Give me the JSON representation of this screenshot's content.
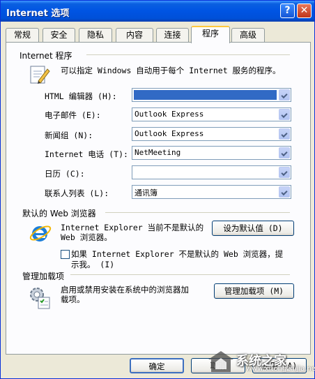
{
  "window": {
    "title": "Internet 选项",
    "help_glyph": "?",
    "close_glyph": "✕"
  },
  "tabs": [
    {
      "label": "常规"
    },
    {
      "label": "安全"
    },
    {
      "label": "隐私"
    },
    {
      "label": "内容"
    },
    {
      "label": "连接"
    },
    {
      "label": "程序",
      "active": true
    },
    {
      "label": "高级"
    }
  ],
  "programs": {
    "group_title": "Internet 程序",
    "description": "可以指定 Windows 自动用于每个 Internet 服务的程序。",
    "rows": [
      {
        "label": "HTML 编辑器 (H):",
        "value": "",
        "selected": true
      },
      {
        "label": "电子邮件 (E):",
        "value": "Outlook Express"
      },
      {
        "label": "新闻组 (N):",
        "value": "Outlook Express"
      },
      {
        "label": "Internet 电话 (T):",
        "value": "NetMeeting"
      },
      {
        "label": "日历 (C):",
        "value": ""
      },
      {
        "label": "联系人列表 (L):",
        "value": "通讯簿"
      }
    ]
  },
  "browser": {
    "group_title": "默认的 Web 浏览器",
    "status_line1": "Internet Explorer 当前不是默认的",
    "status_line2": "Web 浏览器。",
    "set_default_label": "设为默认值 (D)",
    "check_line1": "如果 Internet Explorer 不是默认的 Web 浏览器，提",
    "check_line2": "示我。 (I)",
    "checked": false
  },
  "addons": {
    "group_title": "管理加载项",
    "desc_line1": "启用或禁用安装在系统中的浏览器加",
    "desc_line2": "载项。",
    "manage_label": "管理加载项 (M)"
  },
  "footer": {
    "ok_label": "确定",
    "cancel_label": "取消",
    "apply_label": "应用 (A)"
  },
  "watermark": {
    "text": "系统之家",
    "url": "www.xitongzhijia.net"
  },
  "colors": {
    "titlebar": "#0054e3",
    "selection": "#316ac5",
    "tab_accent": "#ffc83c"
  }
}
